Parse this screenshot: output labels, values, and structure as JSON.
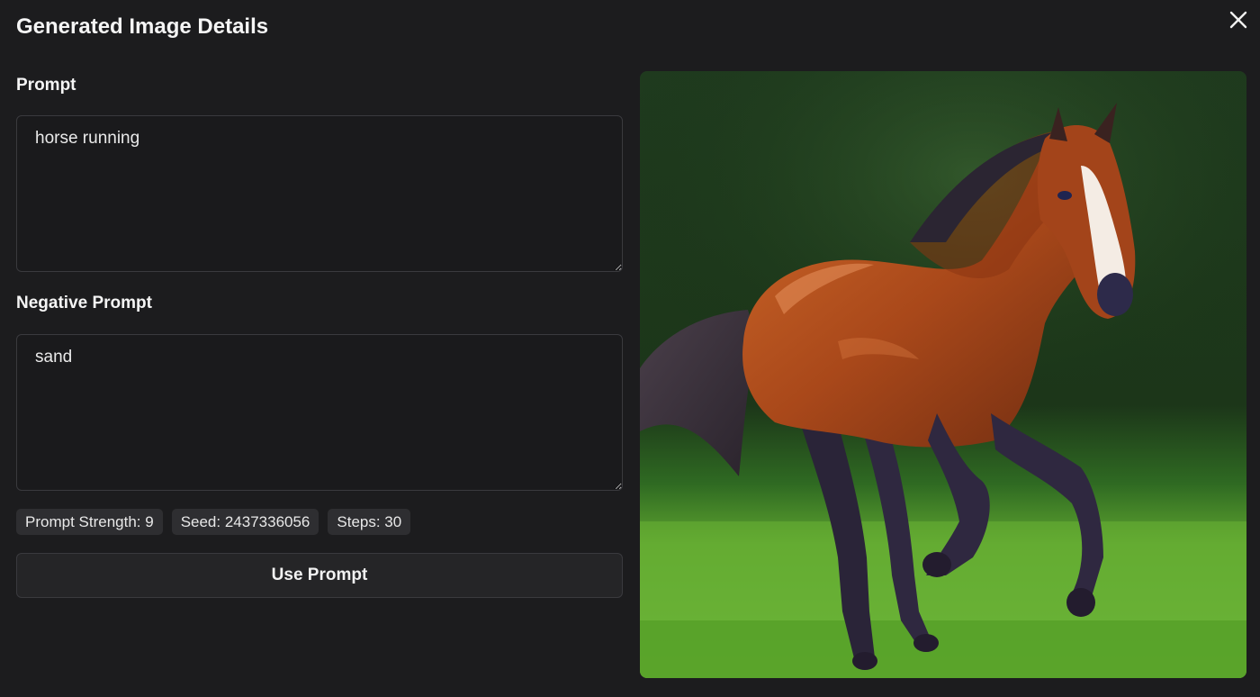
{
  "modal": {
    "title": "Generated Image Details",
    "close_icon": "close-icon"
  },
  "prompt": {
    "label": "Prompt",
    "value": "horse running"
  },
  "negative_prompt": {
    "label": "Negative Prompt",
    "value": "sand"
  },
  "badges": [
    "Prompt Strength: 9",
    "Seed: 2437336056",
    "Steps: 30"
  ],
  "actions": {
    "use_prompt_label": "Use Prompt"
  },
  "colors": {
    "background": "#1c1c1e",
    "badge_bg": "#2e2e31",
    "field_border": "#3a3a3e"
  }
}
